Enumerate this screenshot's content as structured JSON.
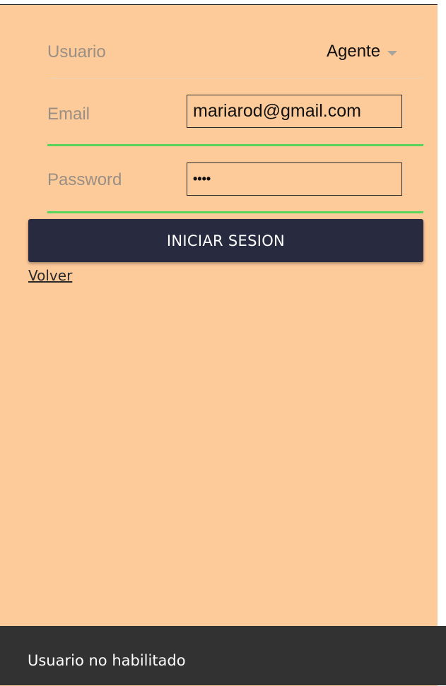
{
  "form": {
    "user_row": {
      "label": "Usuario",
      "selected_value": "Agente"
    },
    "email_row": {
      "label": "Email",
      "value": "mariarod@gmail.com"
    },
    "password_row": {
      "label": "Password",
      "value": "••••"
    },
    "submit_label": "INICIAR SESION",
    "back_link": "Volver"
  },
  "snackbar": {
    "message": "Usuario no habilitado"
  },
  "colors": {
    "background": "#fdca9a",
    "button": "#282a40",
    "focus_underline": "#5ad35a",
    "snackbar": "#323232"
  }
}
